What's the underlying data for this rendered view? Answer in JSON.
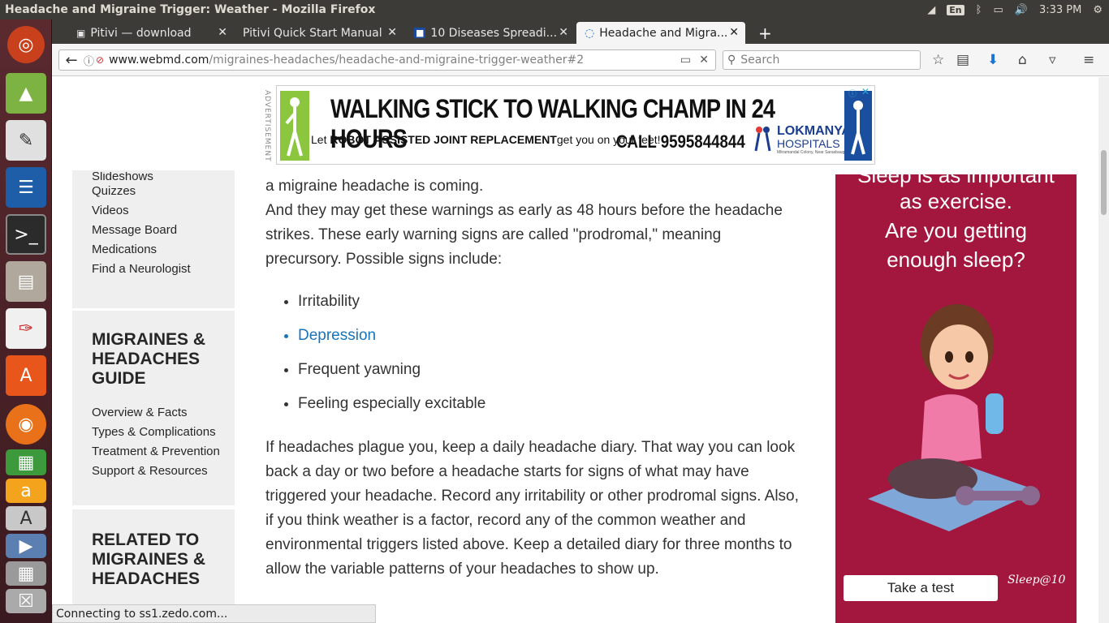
{
  "window": {
    "title": "Headache and Migraine Trigger: Weather - Mozilla Firefox",
    "time": "3:33 PM",
    "keyboard": "En"
  },
  "tabs": [
    {
      "label": "Pitivi — download"
    },
    {
      "label": "Pitivi Quick Start Manual"
    },
    {
      "label": "10 Diseases Spreadi..."
    },
    {
      "label": "Headache and Migra..."
    }
  ],
  "navbar": {
    "url_domain": "www.webmd.com",
    "url_path": "/migraines-headaches/headache-and-migraine-trigger-weather#2",
    "search_placeholder": "Search"
  },
  "banner": {
    "label": "ADVERTISEMENT",
    "headline": "WALKING STICK TO WALKING CHAMP IN 24 HOURS",
    "sub_prefix": "Let ",
    "sub_bold": "ROBOT ASSISTED JOINT REPLACEMENT",
    "sub_suffix": "get you on your feet!",
    "phone": "CALL 9595844844",
    "brand_line1": "LOKMANYA",
    "brand_line2": "HOSPITALS",
    "brand_addr": "Mitramandal Colony, Near Sarasbaug"
  },
  "sidebar": {
    "top_links": [
      "Slideshows",
      "Quizzes",
      "Videos",
      "Message Board",
      "Medications",
      "Find a Neurologist"
    ],
    "guide_heading": [
      "MIGRAINES &",
      "HEADACHES",
      "GUIDE"
    ],
    "guide_links": [
      "Overview & Facts",
      "Types & Complications",
      "Treatment & Prevention",
      "Support & Resources"
    ],
    "related_heading": [
      "RELATED TO",
      "MIGRAINES &",
      "HEADACHES"
    ]
  },
  "article": {
    "p1": "a migraine headache is coming.",
    "p2": "And they may get these warnings as early as 48 hours before the headache strikes. These early warning signs are called \"prodromal,\" meaning precursory. Possible signs include:",
    "signs": [
      "Irritability",
      "Depression",
      "Frequent yawning",
      "Feeling especially excitable"
    ],
    "p3": "If headaches plague you, keep a daily headache diary. That way you can look back a day or two before a headache starts for signs of what may have triggered your headache. Record any irritability or other prodromal signs. Also, if you think weather is a factor, record any of the common weather and environmental triggers listed above. Keep a detailed diary for three months to allow the variable patterns of your headaches to show up."
  },
  "right_ad": {
    "line1": "Sleep is as important",
    "line2": "as exercise.",
    "line3": "Are you getting",
    "line4": "enough sleep?",
    "button": "Take a test",
    "logo": "Sleep@10"
  },
  "status_text": "Connecting to ss1.zedo.com..."
}
